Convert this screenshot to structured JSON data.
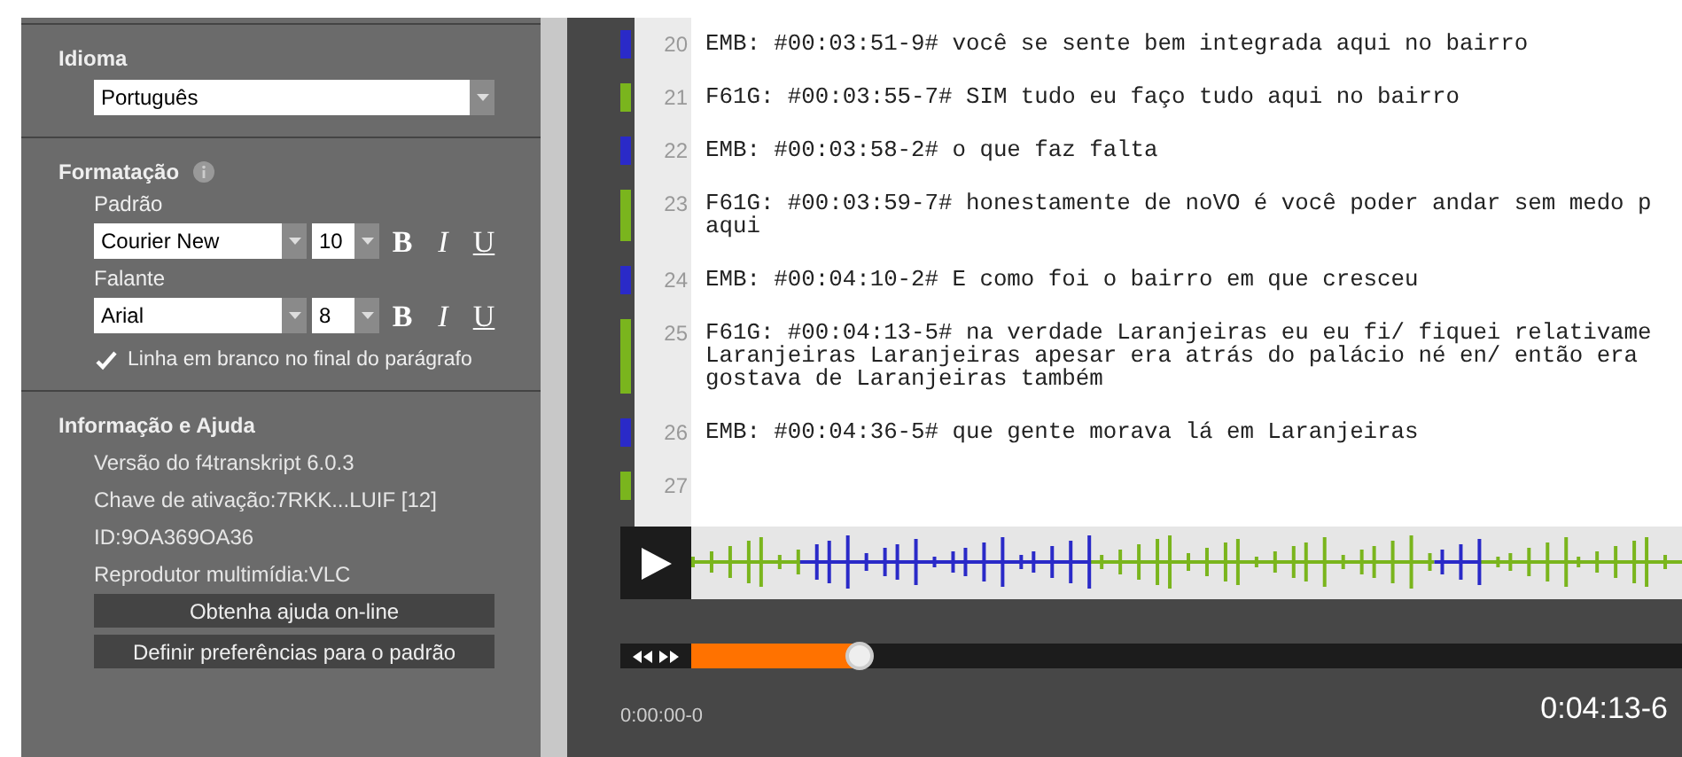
{
  "sidebar": {
    "language": {
      "heading": "Idioma",
      "value": "Português"
    },
    "formatting": {
      "heading": "Formatação",
      "styles": [
        {
          "label": "Padrão",
          "font": "Courier New",
          "size": "10",
          "bold": "B",
          "italic": "I",
          "underline": "U"
        },
        {
          "label": "Falante",
          "font": "Arial",
          "size": "8",
          "bold": "B",
          "italic": "I",
          "underline": "U"
        }
      ],
      "blank_line": {
        "label": "Linha em branco no final do parágrafo",
        "checked": true
      }
    },
    "info": {
      "heading": "Informação e Ajuda",
      "lines": [
        "Versão do f4transkript 6.0.3",
        "Chave de ativação:7RKK...LUIF [12]",
        "ID:9OA369OA36",
        "Reprodutor multimídia:VLC"
      ],
      "buttons": [
        "Obtenha ajuda on-line",
        "Definir preferências para o padrão"
      ]
    }
  },
  "transcript": [
    {
      "number": "20",
      "color": "#2a2ac8",
      "lines": [
        "EMB: #00:03:51-9# você se sente bem integrada aqui no bairro"
      ]
    },
    {
      "number": "21",
      "color": "#7ab51d",
      "lines": [
        "F61G: #00:03:55-7# SIM tudo eu faço tudo aqui no bairro"
      ]
    },
    {
      "number": "22",
      "color": "#2a2ac8",
      "lines": [
        "EMB: #00:03:58-2# o que faz falta"
      ]
    },
    {
      "number": "23",
      "color": "#7ab51d",
      "lines": [
        "F61G: #00:03:59-7# honestamente de noVO é você poder andar sem medo p",
        "aqui"
      ]
    },
    {
      "number": "24",
      "color": "#2a2ac8",
      "lines": [
        "EMB: #00:04:10-2# E como foi o bairro em que cresceu"
      ]
    },
    {
      "number": "25",
      "color": "#7ab51d",
      "lines": [
        "F61G: #00:04:13-5# na verdade Laranjeiras eu eu fi/ fiquei relativame",
        "Laranjeiras Laranjeiras apesar era atrás do palácio né en/ então era",
        "gostava de Laranjeiras também"
      ]
    },
    {
      "number": "26",
      "color": "#2a2ac8",
      "lines": [
        "EMB: #00:04:36-5# que gente morava lá em Laranjeiras"
      ]
    },
    {
      "number": "27",
      "color": "#7ab51d"
    }
  ],
  "player": {
    "level": 0.17,
    "start_time": "0:00:00-0",
    "current_time": "0:04:13-6"
  }
}
